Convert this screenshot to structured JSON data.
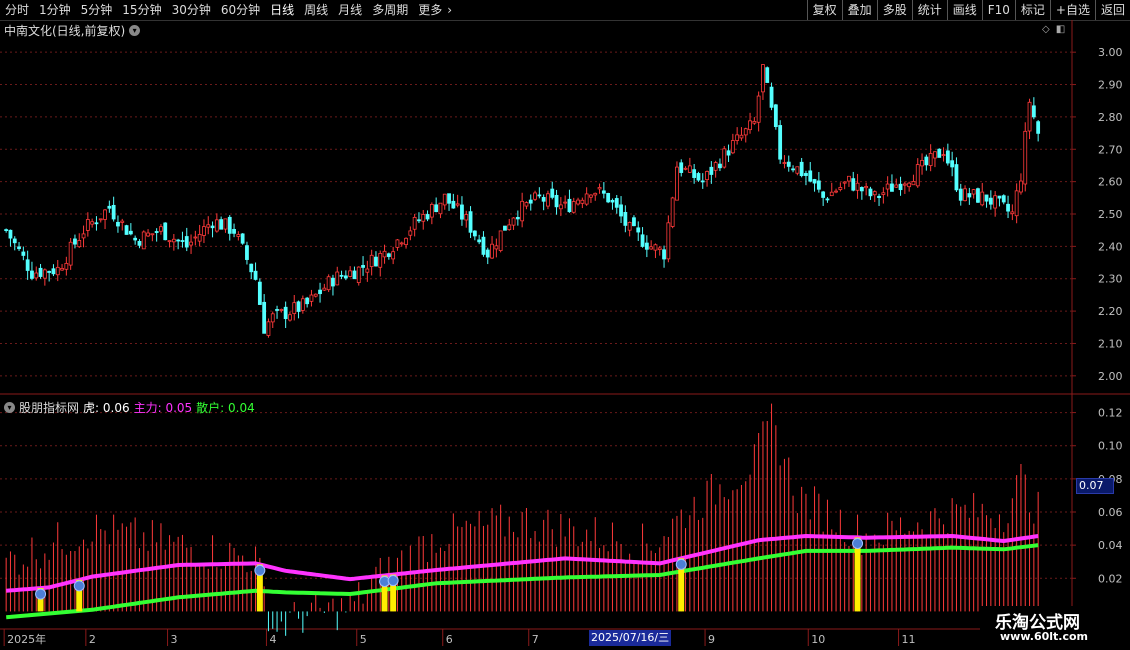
{
  "toolbar": {
    "periods": [
      "分时",
      "1分钟",
      "5分钟",
      "15分钟",
      "30分钟",
      "60分钟",
      "日线",
      "周线",
      "月线",
      "多周期",
      "更多"
    ],
    "active_index": 6,
    "more_icon": "chevron-right-icon",
    "actions": [
      "复权",
      "叠加",
      "多股",
      "统计",
      "画线",
      "F10",
      "标记",
      "+自选",
      "返回"
    ]
  },
  "main_chart": {
    "title": "中南文化(日线,前复权)",
    "title_icon": "chevron-down-icon"
  },
  "indicator": {
    "name": "股朋指标网",
    "fields": [
      {
        "label": "虎:",
        "value": "0.06",
        "color": "#ffffff"
      },
      {
        "label": "主力:",
        "value": "0.05",
        "color": "#ff33ff"
      },
      {
        "label": "散户:",
        "value": "0.04",
        "color": "#33ff33"
      }
    ],
    "current_value_badge": "0.07"
  },
  "colors": {
    "up": "#ff3a3a",
    "down": "#54ffff",
    "grid": "#6a1a1a",
    "axis": "#8a1a1a",
    "main_line": "#ff33ff",
    "retail_line": "#33ff33",
    "signal": "#ffee00"
  },
  "date_axis": {
    "labels": [
      "2025年",
      "2",
      "3",
      "4",
      "5",
      "6",
      "7",
      "9",
      "10",
      "11"
    ],
    "highlight_label": "2025/07/16/三"
  },
  "watermark": {
    "line1": "乐淘公式网",
    "line2": "www.60lt.com"
  },
  "chart_data": [
    {
      "type": "candlestick",
      "title": "中南文化(日线,前复权)",
      "y_ticks": [
        2.0,
        2.1,
        2.2,
        2.3,
        2.4,
        2.5,
        2.6,
        2.7,
        2.8,
        2.9,
        3.0
      ],
      "ylim": [
        1.95,
        3.05
      ],
      "grid": true,
      "close_keypoints": [
        [
          0,
          2.45
        ],
        [
          6,
          2.32
        ],
        [
          12,
          2.33
        ],
        [
          18,
          2.45
        ],
        [
          24,
          2.52
        ],
        [
          30,
          2.42
        ],
        [
          36,
          2.45
        ],
        [
          42,
          2.4
        ],
        [
          48,
          2.48
        ],
        [
          53,
          2.45
        ],
        [
          58,
          2.3
        ],
        [
          60,
          2.15
        ],
        [
          62,
          2.18
        ],
        [
          70,
          2.22
        ],
        [
          76,
          2.3
        ],
        [
          82,
          2.33
        ],
        [
          88,
          2.38
        ],
        [
          95,
          2.47
        ],
        [
          102,
          2.55
        ],
        [
          107,
          2.48
        ],
        [
          112,
          2.38
        ],
        [
          118,
          2.5
        ],
        [
          124,
          2.55
        ],
        [
          130,
          2.52
        ],
        [
          136,
          2.58
        ],
        [
          140,
          2.55
        ],
        [
          145,
          2.45
        ],
        [
          150,
          2.4
        ],
        [
          153,
          2.38
        ],
        [
          156,
          2.65
        ],
        [
          162,
          2.6
        ],
        [
          168,
          2.7
        ],
        [
          174,
          2.78
        ],
        [
          176,
          2.95
        ],
        [
          180,
          2.68
        ],
        [
          186,
          2.62
        ],
        [
          190,
          2.55
        ],
        [
          196,
          2.6
        ],
        [
          202,
          2.55
        ],
        [
          208,
          2.6
        ],
        [
          214,
          2.65
        ],
        [
          218,
          2.7
        ],
        [
          222,
          2.56
        ],
        [
          228,
          2.55
        ],
        [
          234,
          2.5
        ],
        [
          236,
          2.62
        ],
        [
          238,
          2.85
        ],
        [
          240,
          2.75
        ]
      ]
    },
    {
      "type": "bar+line",
      "title": "股朋指标网",
      "y_ticks": [
        0.02,
        0.04,
        0.06,
        0.08,
        0.1,
        0.12
      ],
      "ylim": [
        -0.01,
        0.13
      ],
      "series": [
        {
          "name": "主力",
          "keypoints": [
            [
              0,
              0.0125
            ],
            [
              10,
              0.0145
            ],
            [
              20,
              0.021
            ],
            [
              40,
              0.028
            ],
            [
              58,
              0.029
            ],
            [
              65,
              0.0245
            ],
            [
              80,
              0.0195
            ],
            [
              100,
              0.025
            ],
            [
              130,
              0.032
            ],
            [
              152,
              0.029
            ],
            [
              175,
              0.043
            ],
            [
              186,
              0.0455
            ],
            [
              200,
              0.0445
            ],
            [
              220,
              0.0455
            ],
            [
              232,
              0.0425
            ],
            [
              240,
              0.0455
            ]
          ]
        },
        {
          "name": "散户",
          "keypoints": [
            [
              0,
              -0.0035
            ],
            [
              20,
              0.001
            ],
            [
              40,
              0.0085
            ],
            [
              58,
              0.0125
            ],
            [
              65,
              0.0115
            ],
            [
              80,
              0.0105
            ],
            [
              100,
              0.017
            ],
            [
              130,
              0.0205
            ],
            [
              152,
              0.022
            ],
            [
              175,
              0.032
            ],
            [
              186,
              0.0365
            ],
            [
              200,
              0.0365
            ],
            [
              220,
              0.0385
            ],
            [
              232,
              0.0375
            ],
            [
              240,
              0.04
            ]
          ]
        },
        {
          "name": "虎",
          "keypoints": [
            [
              0,
              0.03
            ],
            [
              20,
              0.05
            ],
            [
              40,
              0.04
            ],
            [
              58,
              0.032
            ],
            [
              62,
              -0.01
            ],
            [
              70,
              -0.002
            ],
            [
              80,
              0.002
            ],
            [
              86,
              0.02
            ],
            [
              100,
              0.045
            ],
            [
              120,
              0.055
            ],
            [
              150,
              0.04
            ],
            [
              158,
              0.06
            ],
            [
              174,
              0.09
            ],
            [
              178,
              0.115
            ],
            [
              184,
              0.07
            ],
            [
              200,
              0.045
            ],
            [
              220,
              0.06
            ],
            [
              232,
              0.06
            ],
            [
              236,
              0.08
            ],
            [
              240,
              0.06
            ]
          ]
        }
      ],
      "signals": [
        8,
        17,
        59,
        88,
        90,
        157,
        198
      ]
    }
  ]
}
